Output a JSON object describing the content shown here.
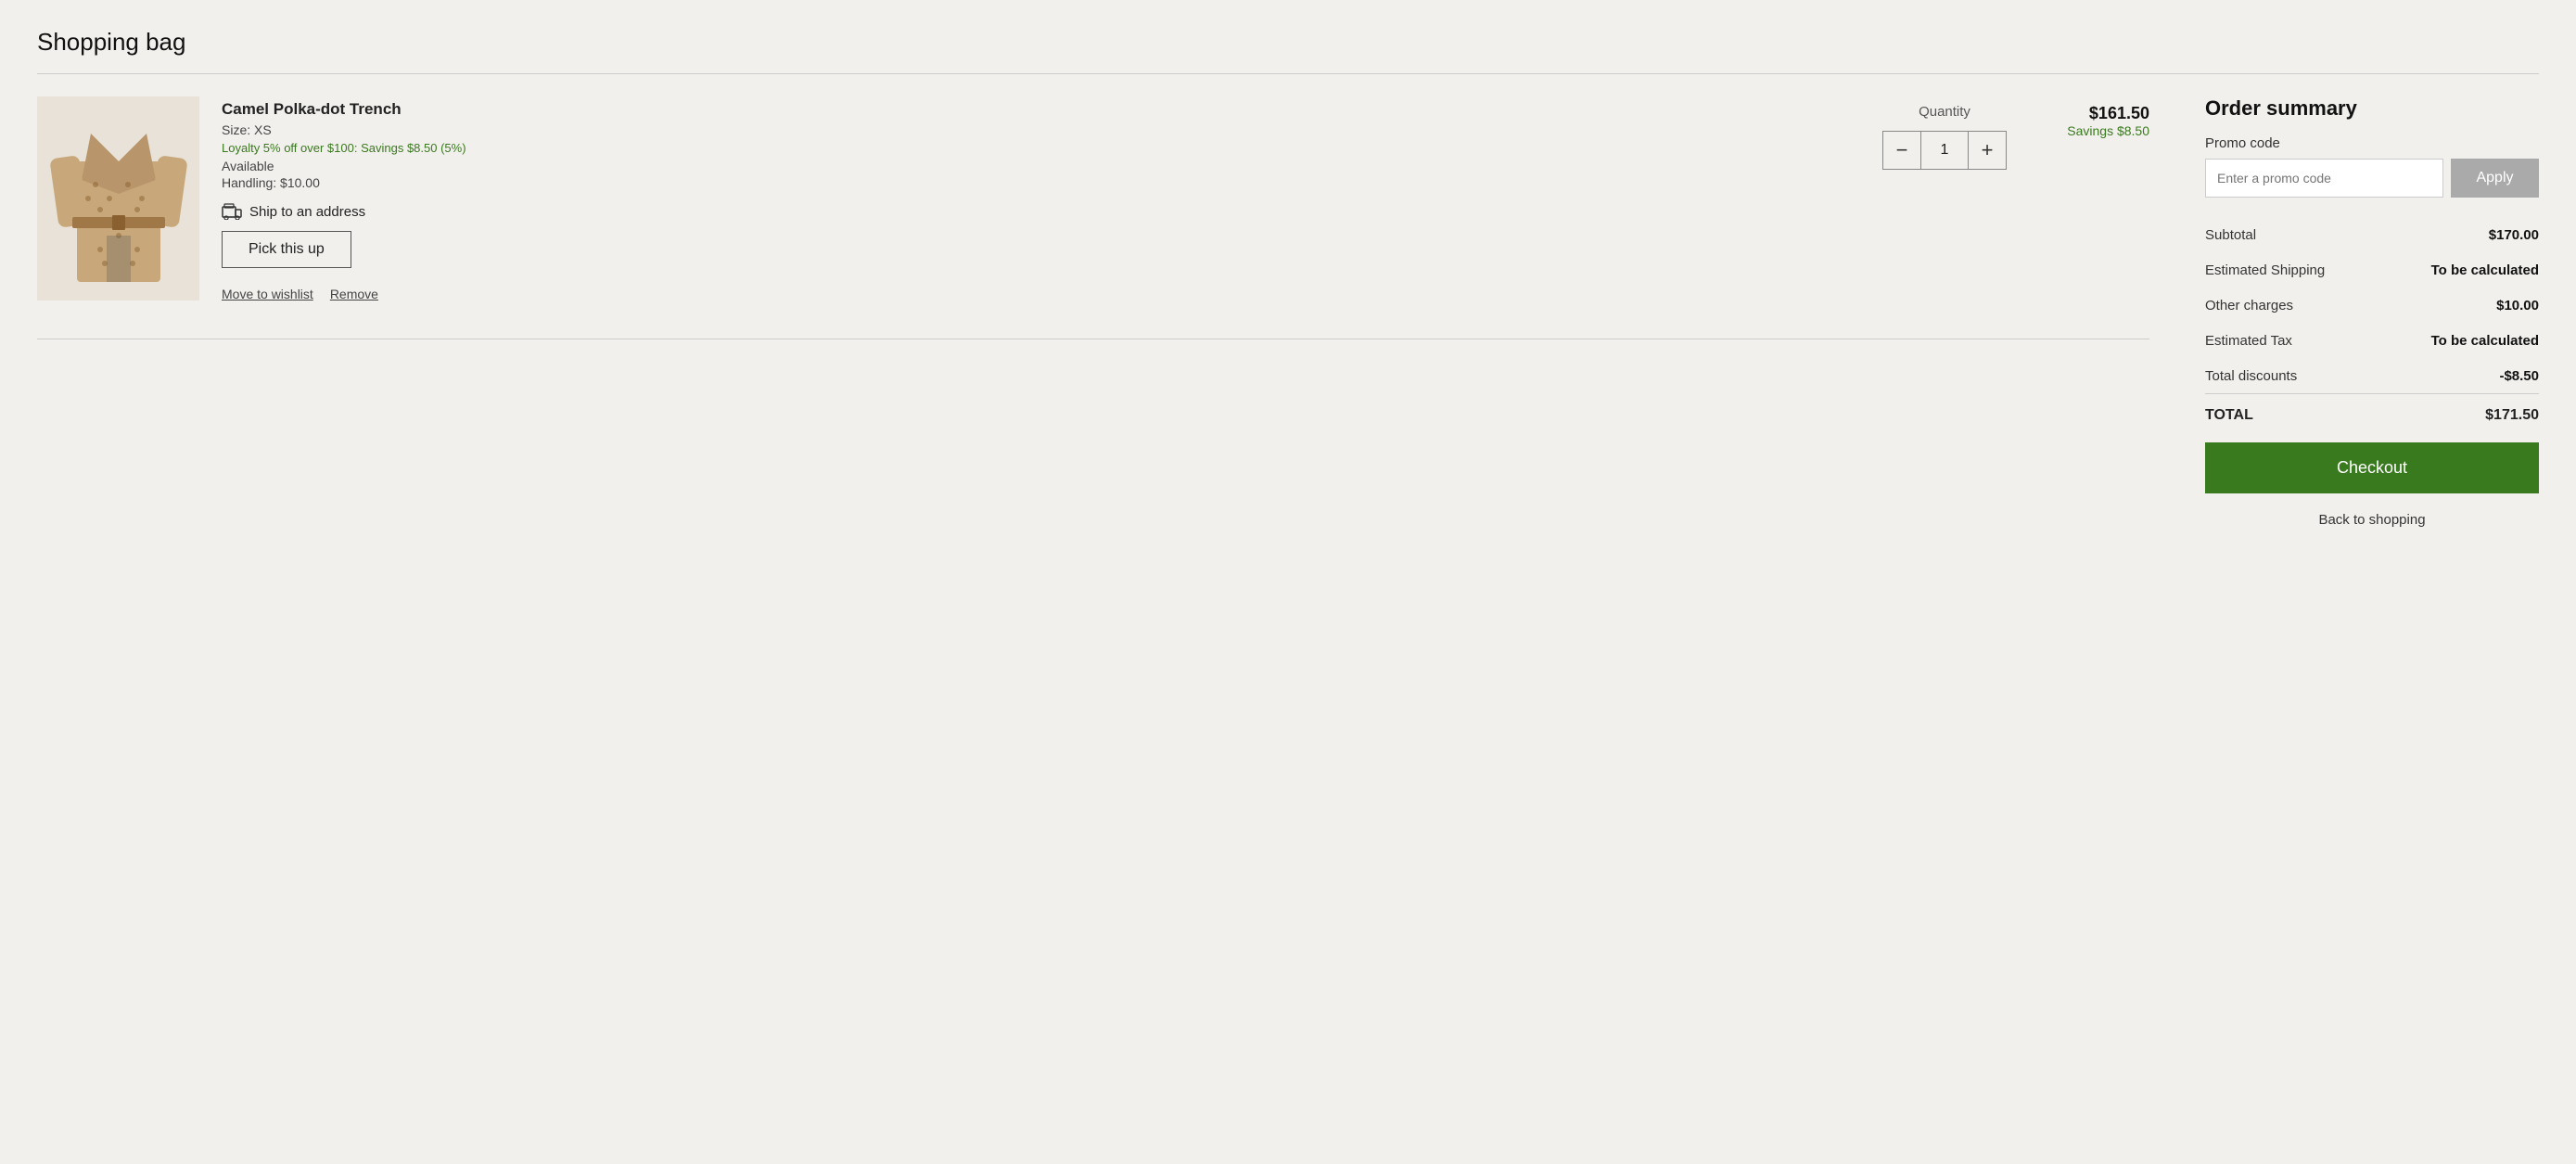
{
  "page": {
    "title": "Shopping bag"
  },
  "cart": {
    "item": {
      "name": "Camel Polka-dot Trench",
      "size": "Size: XS",
      "loyalty": "Loyalty 5% off over $100: Savings $8.50 (5%)",
      "availability": "Available",
      "handling": "Handling: $10.00",
      "ship_label": "Ship to an address",
      "pickup_btn": "Pick this up",
      "quantity_label": "Quantity",
      "quantity_value": "1",
      "minus_label": "−",
      "plus_label": "+",
      "price": "$161.50",
      "savings": "Savings $8.50",
      "move_to_wishlist": "Move to wishlist",
      "remove": "Remove"
    }
  },
  "order_summary": {
    "title": "Order summary",
    "promo_label": "Promo code",
    "promo_placeholder": "Enter a promo code",
    "apply_btn": "Apply",
    "rows": [
      {
        "label": "Subtotal",
        "value": "$170.00",
        "bold": true
      },
      {
        "label": "Estimated Shipping",
        "value": "To be calculated",
        "bold": true
      },
      {
        "label": "Other charges",
        "value": "$10.00",
        "bold": true
      },
      {
        "label": "Estimated Tax",
        "value": "To be calculated",
        "bold": true
      },
      {
        "label": "Total discounts",
        "value": "-$8.50",
        "bold": true
      }
    ],
    "total_label": "TOTAL",
    "total_value": "$171.50",
    "checkout_btn": "Checkout",
    "back_label": "Back to shopping"
  }
}
